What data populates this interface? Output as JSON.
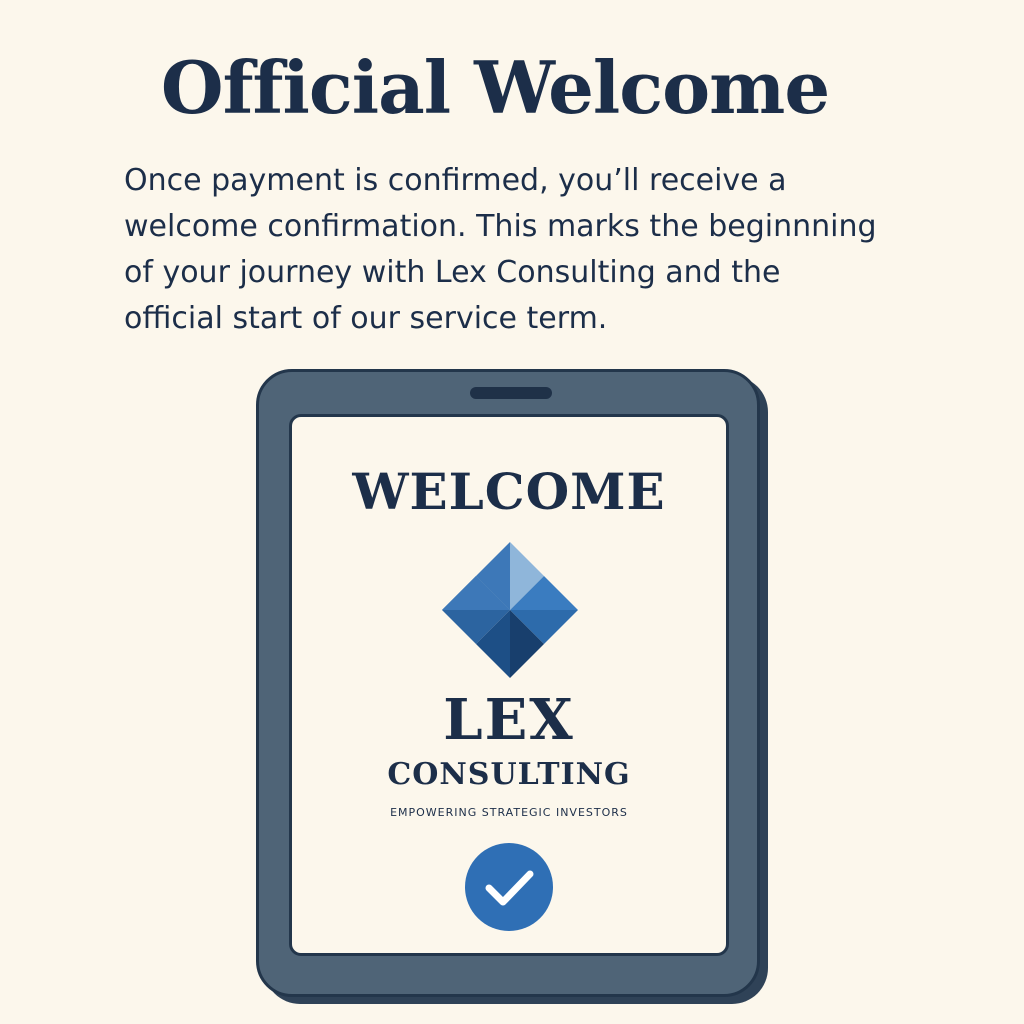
{
  "header": {
    "title": "Official Welcome"
  },
  "intro": {
    "lines": [
      "Once payment is confirmed, you’ll receive a",
      "welcome confirmation. This marks the beginnning",
      "of your journey with Lex Consulting and the",
      "official start of our service term."
    ]
  },
  "tablet": {
    "screen_title": "WELCOME",
    "logo_icon": "diamond-logo-icon",
    "brand_name": "LEX",
    "brand_sub": "CONSULTING",
    "tagline": "EMPOWERING STRATEGIC INVESTORS",
    "status_icon": "check-circle-icon"
  },
  "colors": {
    "background": "#fcf7ec",
    "text": "#1c2e49",
    "tablet_frame": "#4f6477",
    "logo_light": "#6a9bcb",
    "logo_mid": "#3d78b8",
    "logo_dark": "#1d4f86",
    "check": "#2f6fb5"
  }
}
